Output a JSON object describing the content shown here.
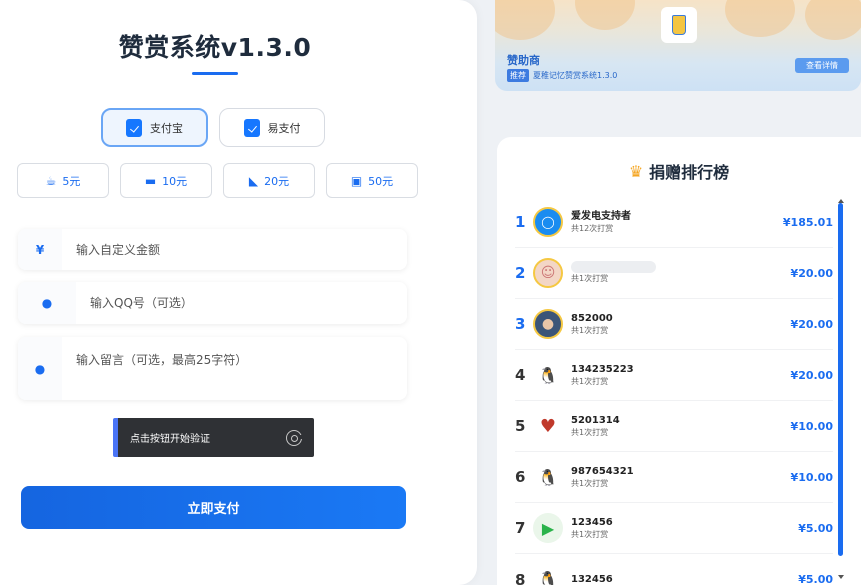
{
  "app": {
    "title": "赞赏系统v1.3.0"
  },
  "payment_methods": [
    {
      "label": "支付宝",
      "active": true
    },
    {
      "label": "易支付",
      "active": false
    }
  ],
  "amounts": [
    {
      "label": "5元",
      "icon": "coffee-icon"
    },
    {
      "label": "10元",
      "icon": "burger-icon"
    },
    {
      "label": "20元",
      "icon": "pizza-icon"
    },
    {
      "label": "50元",
      "icon": "gift-icon"
    }
  ],
  "form": {
    "amount_placeholder": "输入自定义金额",
    "amount_icon": "¥",
    "qq_placeholder": "输入QQ号（可选）",
    "message_placeholder": "输入留言（可选，最高25字符）"
  },
  "captcha": {
    "label": "点击按钮开始验证"
  },
  "submit_label": "立即支付",
  "sponsor": {
    "title": "赞助商",
    "tag": "推荐",
    "subtitle": "夏稚记忆赞赏系统1.3.0",
    "view_label": "查看详情"
  },
  "leaderboard": {
    "title": "捐赠排行榜",
    "entries": [
      {
        "rank": "1",
        "name": "爱发电支持者",
        "count": "共12次打赏",
        "amount": "¥185.01",
        "rank_color": "#1a6cf0"
      },
      {
        "rank": "2",
        "name": "",
        "count": "共1次打赏",
        "amount": "¥20.00",
        "rank_color": "#1a6cf0"
      },
      {
        "rank": "3",
        "name": "852000",
        "count": "共1次打赏",
        "amount": "¥20.00",
        "rank_color": "#1a6cf0"
      },
      {
        "rank": "4",
        "name": "134235223",
        "count": "共1次打赏",
        "amount": "¥20.00",
        "rank_color": "#333333"
      },
      {
        "rank": "5",
        "name": "5201314",
        "count": "共1次打赏",
        "amount": "¥10.00",
        "rank_color": "#333333"
      },
      {
        "rank": "6",
        "name": "987654321",
        "count": "共1次打赏",
        "amount": "¥10.00",
        "rank_color": "#333333"
      },
      {
        "rank": "7",
        "name": "123456",
        "count": "共1次打赏",
        "amount": "¥5.00",
        "rank_color": "#333333"
      },
      {
        "rank": "8",
        "name": "132456",
        "count": "",
        "amount": "¥5.00",
        "rank_color": "#333333"
      }
    ]
  }
}
